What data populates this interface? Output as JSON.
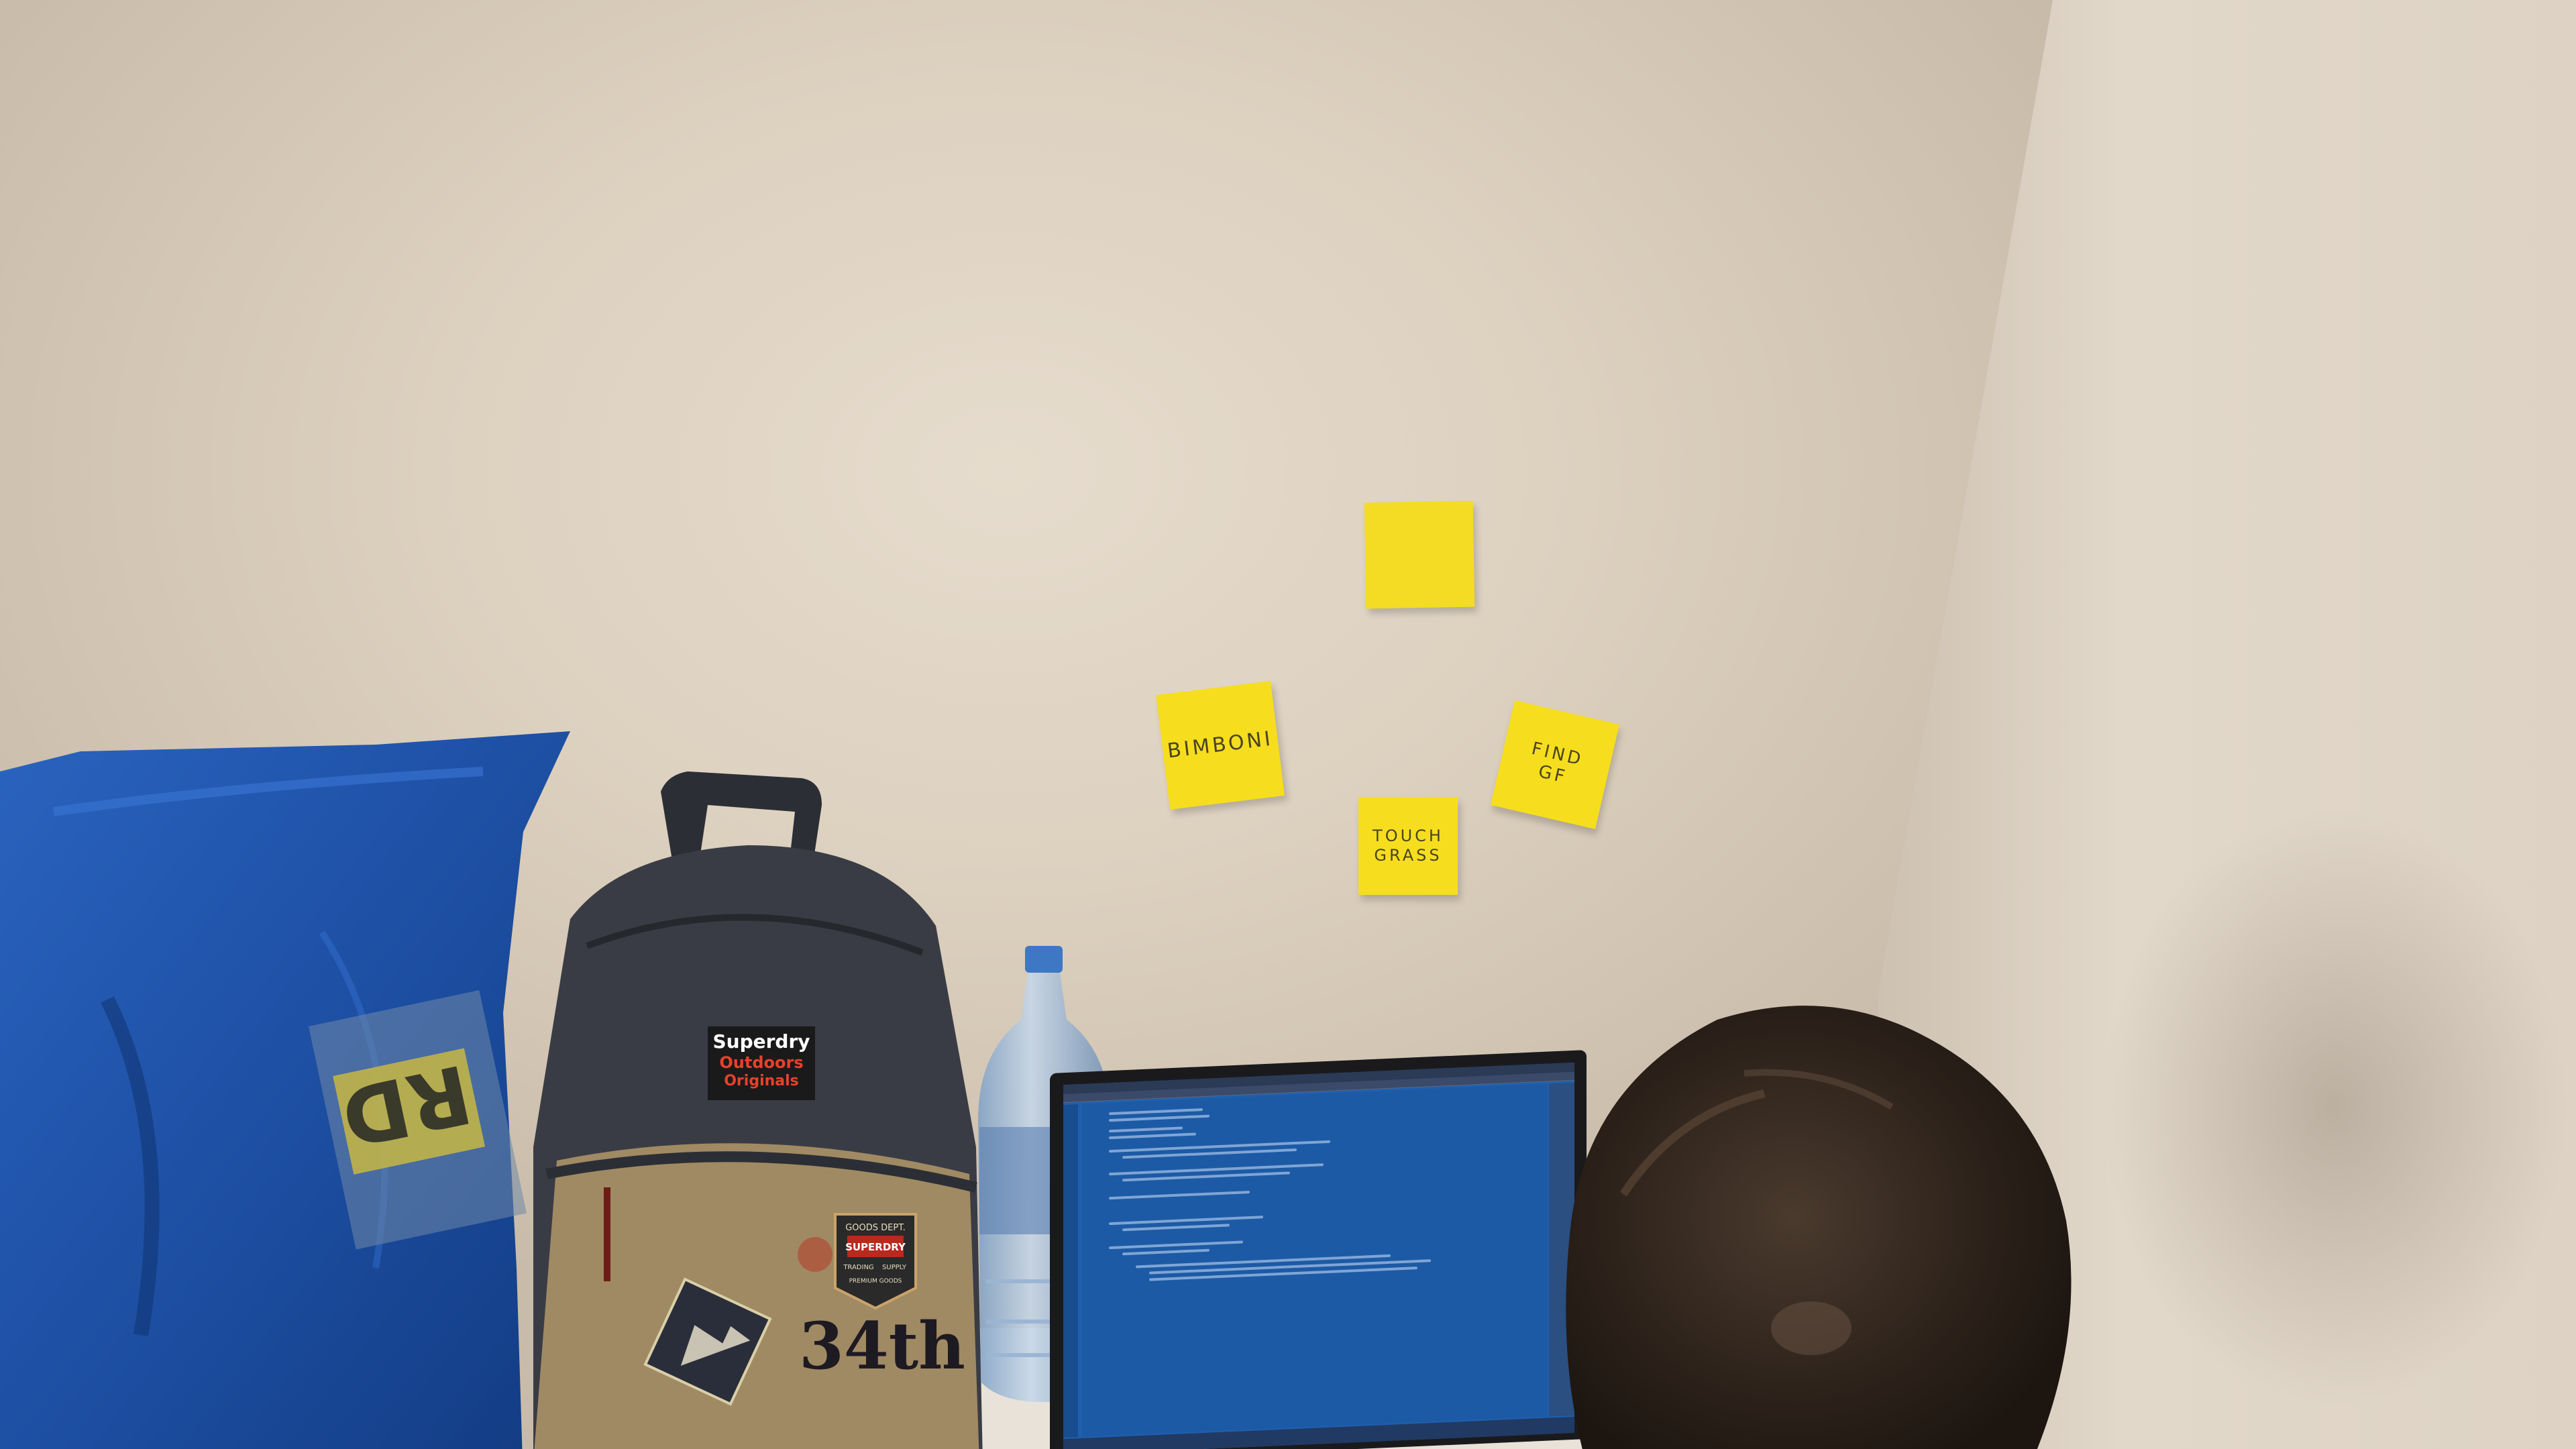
{
  "scene": {
    "sticky_notes": [
      {
        "text": ""
      },
      {
        "text": "BIMBONI"
      },
      {
        "text_lines": [
          "TOUCH",
          "GRASS"
        ]
      },
      {
        "text_lines": [
          "FIND",
          "GF"
        ]
      }
    ],
    "backpack": {
      "brand_lines": [
        "Superdry",
        "Outdoors",
        "Originals"
      ],
      "patch_lines": [
        "GOODS DEPT.",
        "SUPERDRY",
        "TRADING",
        "SUPPLY",
        "PREMIUM GOODS"
      ],
      "number": "34th"
    },
    "bag": {
      "tag_text": "RD"
    },
    "colors": {
      "wall": "#e3d9ca",
      "sticky_note": "#f6de1e",
      "bag_blue": "#1d4fa3",
      "backpack_body": "#3a3c45",
      "backpack_bottom": "#a08a63",
      "ide_editor": "#1d5aa5"
    }
  }
}
